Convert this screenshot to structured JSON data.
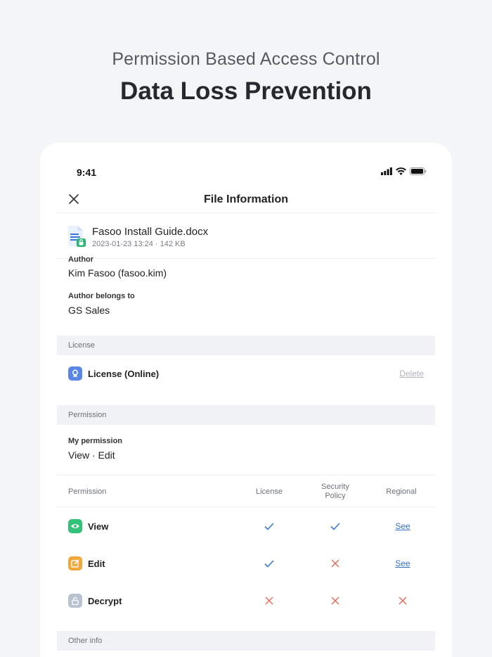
{
  "hero": {
    "subtitle": "Permission Based Access Control",
    "title": "Data Loss Prevention"
  },
  "status_bar": {
    "time": "9:41"
  },
  "navbar": {
    "title": "File Information"
  },
  "file": {
    "name": "Fasoo Install Guide.docx",
    "meta": "2023-01-23  13:24 · 142 KB"
  },
  "author": {
    "label": "Author",
    "value": "Kim Fasoo (fasoo.kim)"
  },
  "author_group": {
    "label": "Author belongs to",
    "value": "GS Sales"
  },
  "license_section": {
    "title": "License",
    "item": "License (Online)",
    "delete_label": "Delete"
  },
  "permission_section": {
    "title": "Permission",
    "my_label": "My permission",
    "my_value": "View · Edit"
  },
  "table": {
    "headers": [
      "Permission",
      "License",
      "Security\nPolicy",
      "Regional"
    ],
    "rows": [
      {
        "name": "View",
        "icon": "eye-icon",
        "color": "#34c279",
        "license": "check",
        "security": "check",
        "regional": "See"
      },
      {
        "name": "Edit",
        "icon": "edit-icon",
        "color": "#f2a73b",
        "license": "check",
        "security": "cross",
        "regional": "See"
      },
      {
        "name": "Decrypt",
        "icon": "unlock-icon",
        "color": "#b9c2d0",
        "license": "cross",
        "security": "cross",
        "regional": "cross"
      }
    ]
  },
  "other_section": {
    "title": "Other info"
  },
  "colors": {
    "check": "#3a78d6",
    "cross": "#ec6a5e",
    "link": "#3570c7"
  }
}
